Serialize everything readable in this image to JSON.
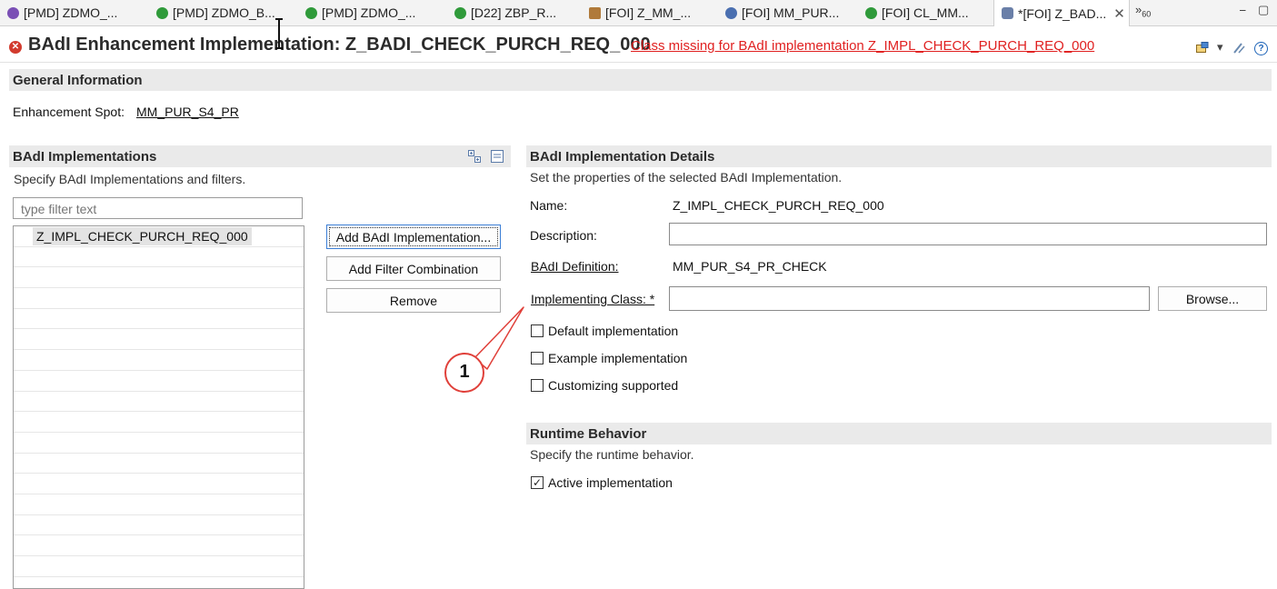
{
  "tabs": [
    {
      "label": "[PMD] ZDMO_...",
      "icon": "pmd-definition-icon",
      "color": "#7a4fb5"
    },
    {
      "label": "[PMD] ZDMO_B...",
      "icon": "green-object-icon",
      "color": "#2f9a3a"
    },
    {
      "label": "[PMD] ZDMO_...",
      "icon": "green-object-icon",
      "color": "#2f9a3a"
    },
    {
      "label": "[D22] ZBP_R...",
      "icon": "green-object-icon",
      "color": "#2f9a3a"
    },
    {
      "label": "[FOI] Z_MM_...",
      "icon": "enhancement-icon",
      "color": "#b07a3a"
    },
    {
      "label": "[FOI] MM_PUR...",
      "icon": "enhancement-spot-icon",
      "color": "#4a6fb0"
    },
    {
      "label": "[FOI] CL_MM...",
      "icon": "green-object-icon",
      "color": "#2f9a3a"
    },
    {
      "label": "*[FOI] Z_BAD...",
      "icon": "badi-impl-icon",
      "color": "#6a7fa8",
      "active": true
    }
  ],
  "overflow": {
    "symbol": "»",
    "count": "60"
  },
  "window": {
    "minimize": "⎯",
    "maximize": "▢"
  },
  "header": {
    "title": "BAdI Enhancement Implementation: Z_BADI_CHECK_PURCH_REQ_000",
    "error": "Class missing for BAdI implementation Z_IMPL_CHECK_PURCH_REQ_000",
    "error_symbol": "✕",
    "help_symbol": "?"
  },
  "general": {
    "title": "General Information",
    "spot_label": "Enhancement Spot:",
    "spot_value": "MM_PUR_S4_PR"
  },
  "impls": {
    "title": "BAdI Implementations",
    "desc": "Specify BAdI Implementations and filters.",
    "filter_placeholder": "type filter text",
    "items": [
      "Z_IMPL_CHECK_PURCH_REQ_000"
    ],
    "buttons": {
      "add_impl": "Add BAdI Implementation...",
      "add_filter": "Add Filter Combination",
      "remove": "Remove"
    }
  },
  "details": {
    "title": "BAdI Implementation Details",
    "desc": "Set the properties of the selected BAdI Implementation.",
    "name_label": "Name:",
    "name_value": "Z_IMPL_CHECK_PURCH_REQ_000",
    "desc_label": "Description:",
    "desc_value": "",
    "def_label": "BAdI Definition:",
    "def_value": "MM_PUR_S4_PR_CHECK",
    "class_label": "Implementing Class: *",
    "class_value": "",
    "browse": "Browse...",
    "default_impl": "Default implementation",
    "example_impl": "Example implementation",
    "customizing": "Customizing supported",
    "default_checked": false,
    "example_checked": false,
    "customizing_checked": false
  },
  "runtime": {
    "title": "Runtime Behavior",
    "desc": "Specify the runtime behavior.",
    "active_label": "Active implementation",
    "active_checked": true,
    "check_symbol": "✓"
  },
  "callout": {
    "number": "1",
    "color": "#e0403a"
  }
}
